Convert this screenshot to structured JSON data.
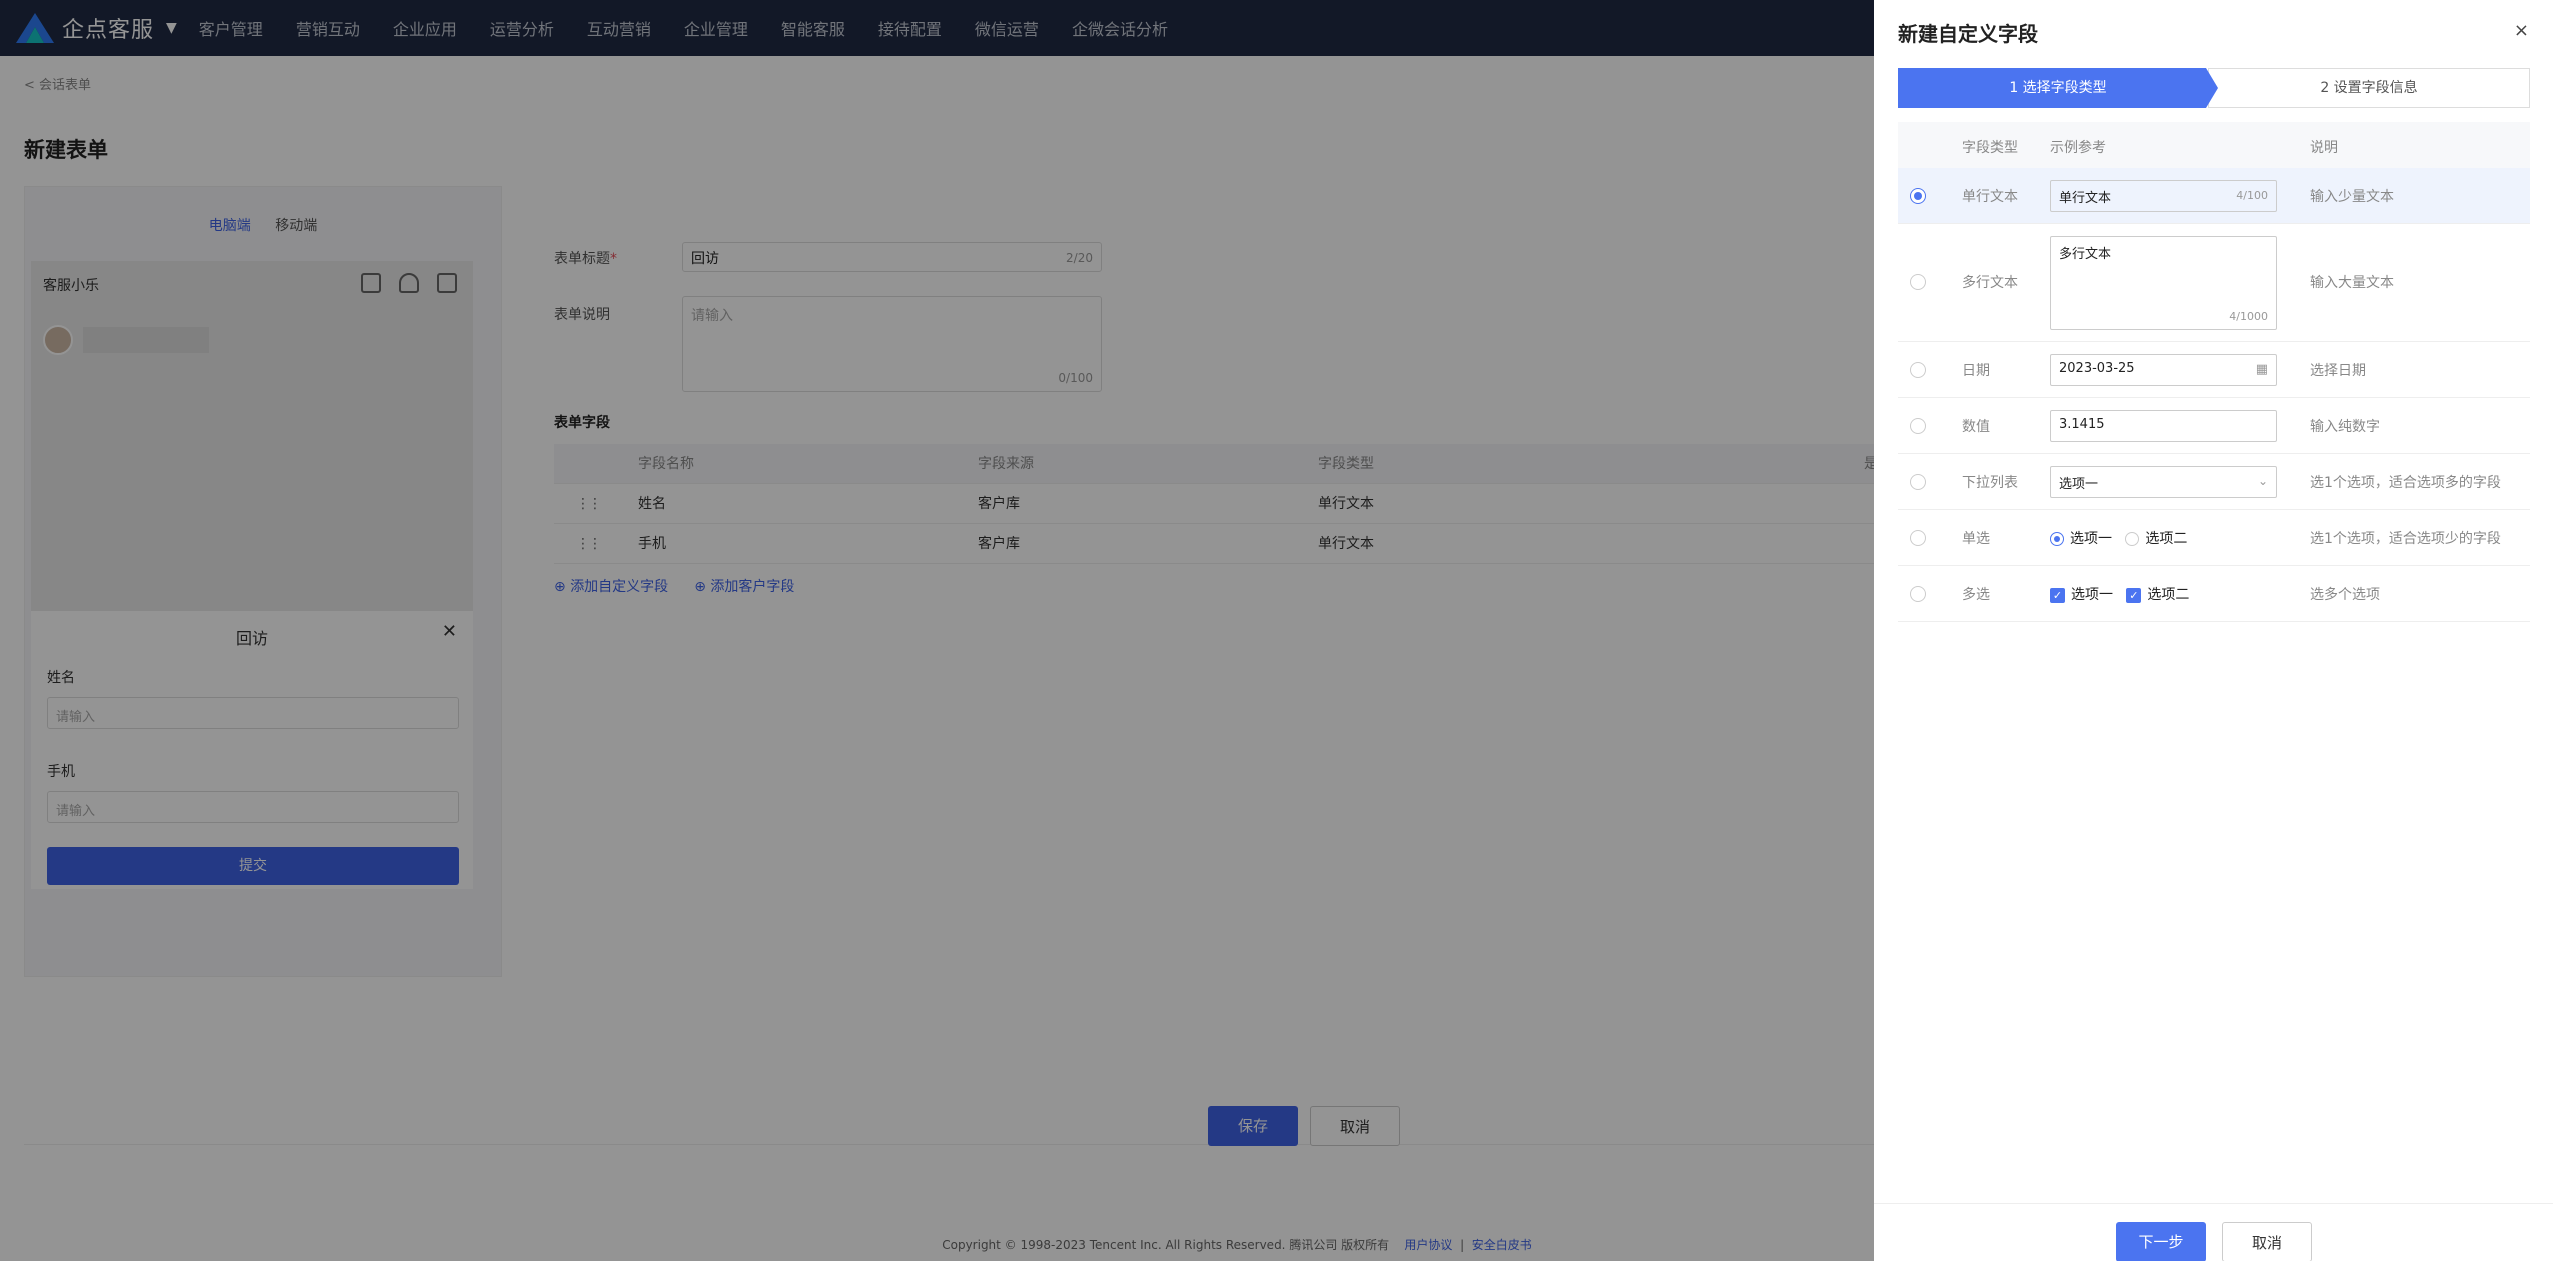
{
  "app": {
    "name": "企点客服"
  },
  "nav": [
    "客户管理",
    "营销互动",
    "企业应用",
    "运营分析",
    "互动营销",
    "企业管理",
    "智能客服",
    "接待配置",
    "微信运营",
    "企微会话分析"
  ],
  "breadcrumb": "< 会话表单",
  "page_title": "新建表单",
  "preview": {
    "tabs": [
      "电脑端",
      "移动端"
    ],
    "header_title": "客服小乐",
    "form_title": "回访",
    "fields": [
      {
        "label": "姓名",
        "placeholder": "请输入"
      },
      {
        "label": "手机",
        "placeholder": "请输入"
      }
    ],
    "submit_label": "提交"
  },
  "form": {
    "title_label": "表单标题",
    "title_value": "回访",
    "title_count": "2/20",
    "desc_label": "表单说明",
    "desc_placeholder": "请输入",
    "desc_count": "0/100",
    "fields_title": "表单字段",
    "columns": [
      "字段名称",
      "字段来源",
      "字段类型",
      "是"
    ],
    "rows": [
      {
        "name": "姓名",
        "source": "客户库",
        "type": "单行文本"
      },
      {
        "name": "手机",
        "source": "客户库",
        "type": "单行文本"
      }
    ],
    "add_custom": "添加自定义字段",
    "add_customer": "添加客户字段"
  },
  "actions": {
    "save": "保存",
    "cancel": "取消"
  },
  "footer": {
    "copyright": "Copyright © 1998-2023 Tencent Inc. All Rights Reserved. 腾讯公司 版权所有",
    "link1": "用户协议",
    "sep": "|",
    "link2": "安全白皮书"
  },
  "drawer": {
    "title": "新建自定义字段",
    "close": "×",
    "steps": [
      "1 选择字段类型",
      "2 设置字段信息"
    ],
    "columns": [
      "字段类型",
      "示例参考",
      "说明"
    ],
    "rows": [
      {
        "type": "单行文本",
        "example": "单行文本",
        "count": "4/100",
        "desc": "输入少量文本",
        "selected": true
      },
      {
        "type": "多行文本",
        "example": "多行文本",
        "count": "4/1000",
        "desc": "输入大量文本",
        "selected": false
      },
      {
        "type": "日期",
        "example": "2023-03-25",
        "desc": "选择日期",
        "selected": false
      },
      {
        "type": "数值",
        "example": "3.1415",
        "desc": "输入纯数字",
        "selected": false
      },
      {
        "type": "下拉列表",
        "example": "选项一",
        "desc": "选1个选项，适合选项多的字段",
        "selected": false
      },
      {
        "type": "单选",
        "opt1": "选项一",
        "opt2": "选项二",
        "desc": "选1个选项，适合选项少的字段",
        "selected": false
      },
      {
        "type": "多选",
        "opt1": "选项一",
        "opt2": "选项二",
        "desc": "选多个选项",
        "selected": false
      }
    ],
    "next": "下一步",
    "cancel": "取消"
  },
  "colors": {
    "accent": "#3f63e6",
    "nav_bg": "#1f2a44"
  }
}
